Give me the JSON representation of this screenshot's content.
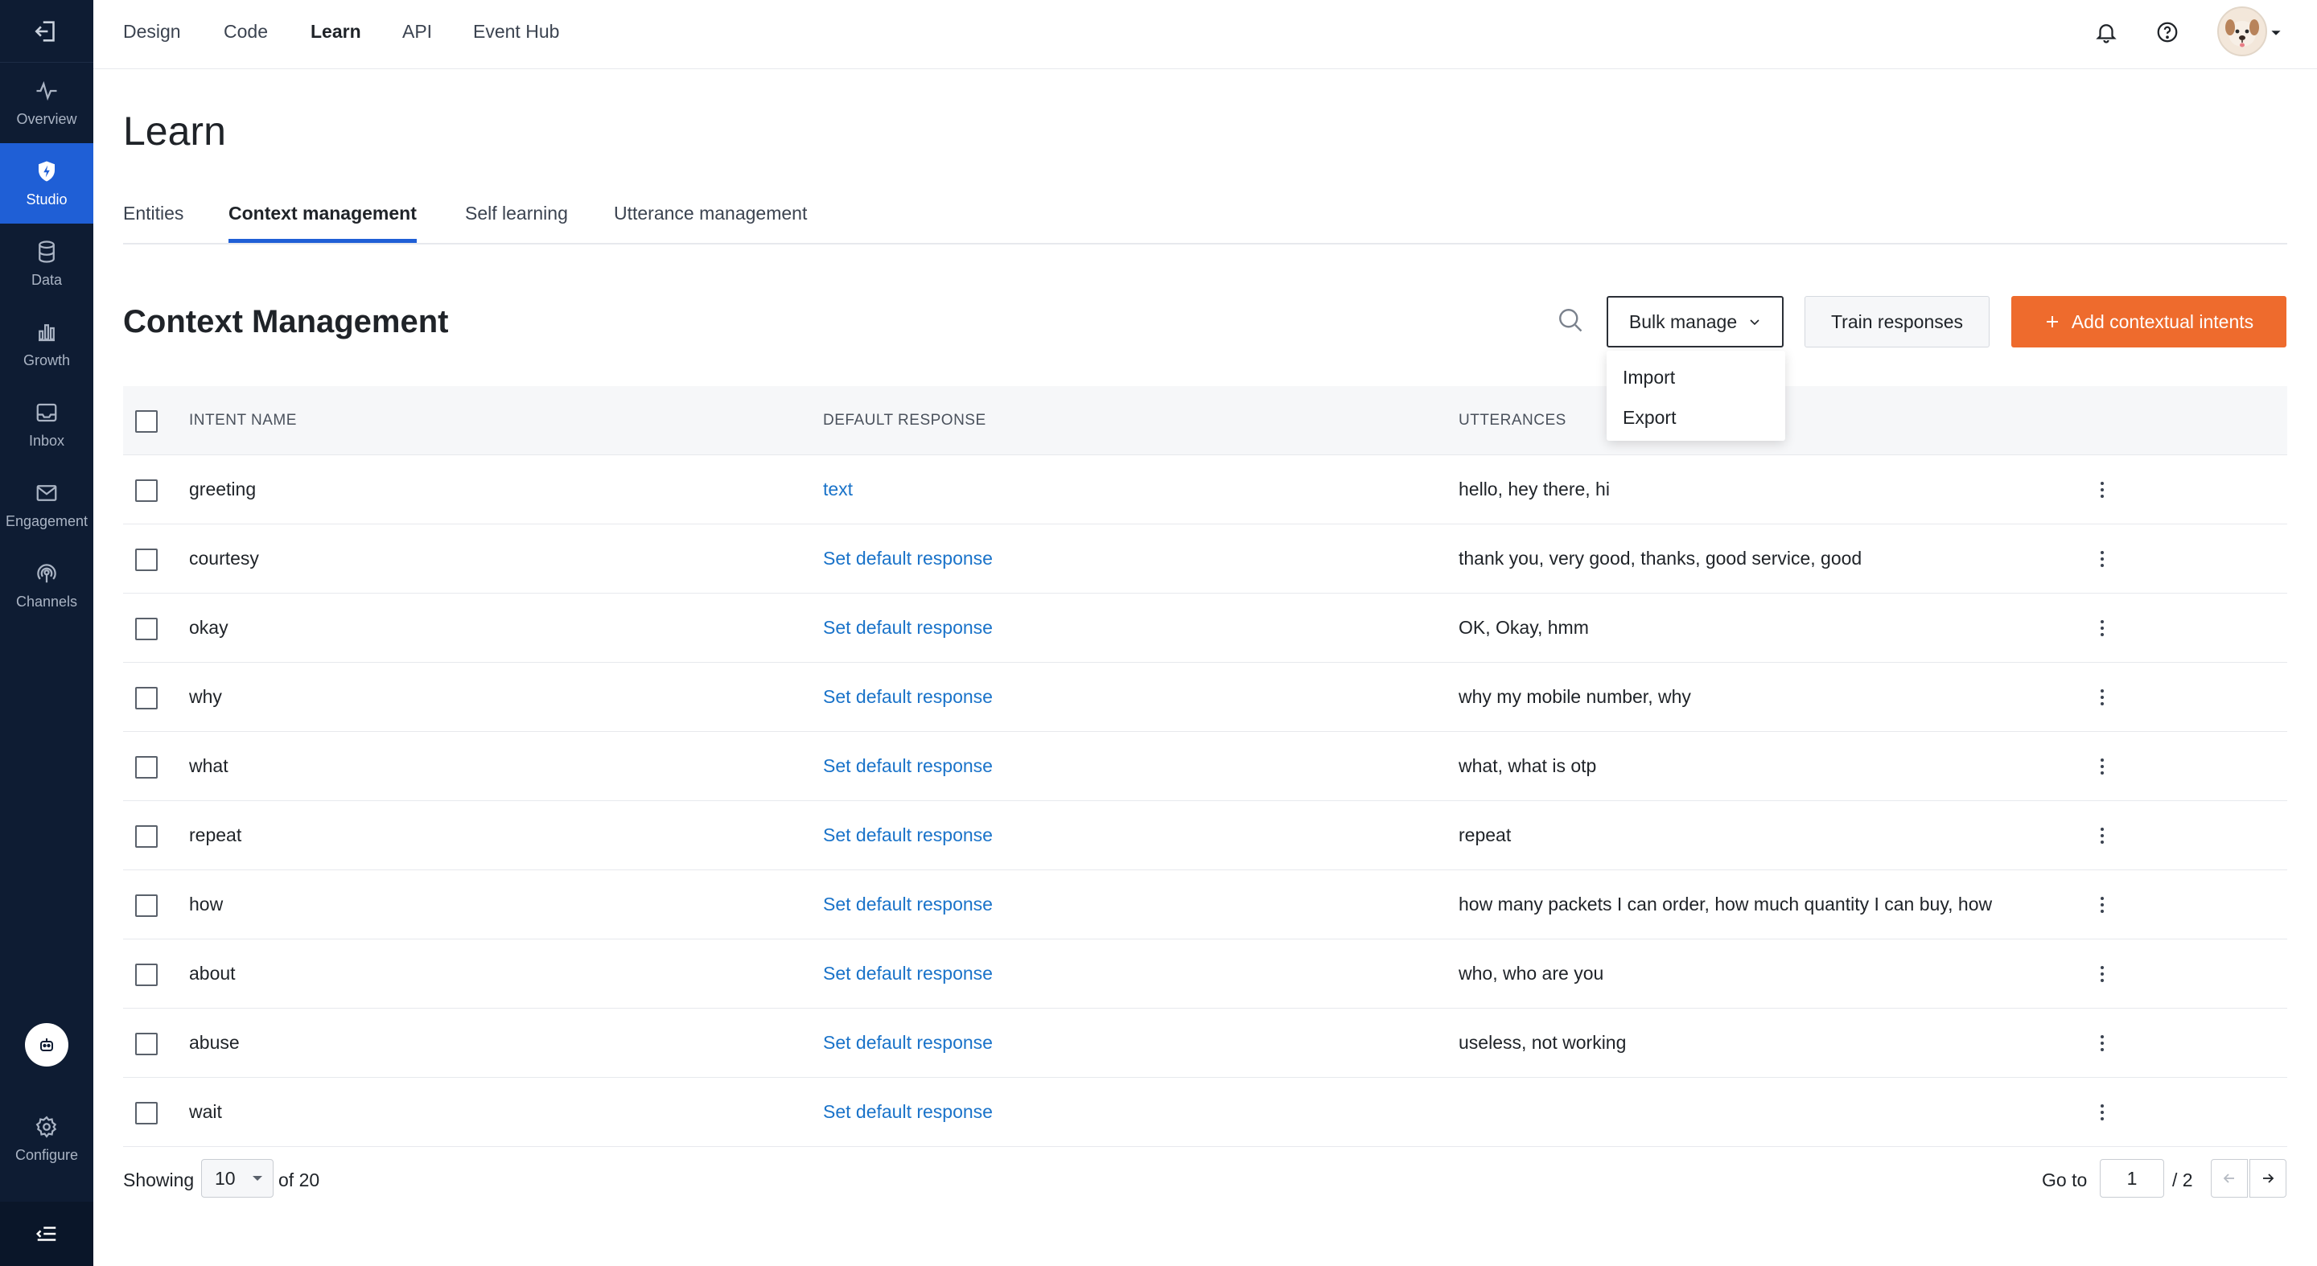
{
  "sidebar": {
    "items": [
      {
        "label": "Overview",
        "icon": "activity-icon"
      },
      {
        "label": "Studio",
        "icon": "shield-bolt-icon",
        "active": true
      },
      {
        "label": "Data",
        "icon": "database-icon"
      },
      {
        "label": "Growth",
        "icon": "bar-chart-icon"
      },
      {
        "label": "Inbox",
        "icon": "inbox-icon"
      },
      {
        "label": "Engagement",
        "icon": "mail-icon"
      },
      {
        "label": "Channels",
        "icon": "broadcast-icon"
      }
    ],
    "configure_label": "Configure"
  },
  "topnav": {
    "links": [
      "Design",
      "Code",
      "Learn",
      "API",
      "Event Hub"
    ],
    "active": "Learn"
  },
  "page": {
    "title": "Learn",
    "tabs": [
      "Entities",
      "Context management",
      "Self learning",
      "Utterance management"
    ],
    "active_tab": "Context management"
  },
  "section": {
    "title": "Context Management",
    "bulk_manage_label": "Bulk manage",
    "train_label": "Train responses",
    "add_label": "Add contextual intents",
    "dropdown": [
      "Import",
      "Export"
    ]
  },
  "table": {
    "headers": [
      "INTENT NAME",
      "DEFAULT RESPONSE",
      "UTTERANCES"
    ],
    "rows": [
      {
        "intent": "greeting",
        "response": "text",
        "utterances": "hello, hey there, hi"
      },
      {
        "intent": "courtesy",
        "response": "Set default response",
        "utterances": "thank you, very good, thanks, good service, good"
      },
      {
        "intent": "okay",
        "response": "Set default response",
        "utterances": "OK, Okay, hmm"
      },
      {
        "intent": "why",
        "response": "Set default response",
        "utterances": "why my mobile number, why"
      },
      {
        "intent": "what",
        "response": "Set default response",
        "utterances": "what, what is otp"
      },
      {
        "intent": "repeat",
        "response": "Set default response",
        "utterances": "repeat"
      },
      {
        "intent": "how",
        "response": "Set default response",
        "utterances": "how many packets I can order, how much quantity I can buy, how"
      },
      {
        "intent": "about",
        "response": "Set default response",
        "utterances": "who, who are you"
      },
      {
        "intent": "abuse",
        "response": "Set default response",
        "utterances": "useless, not working"
      },
      {
        "intent": "wait",
        "response": "Set default response",
        "utterances": ""
      }
    ]
  },
  "footer": {
    "showing_label": "Showing",
    "page_size": "10",
    "of_total": "of 20",
    "goto_label": "Go to",
    "current_page": "1",
    "total_pages": "/ 2"
  },
  "colors": {
    "sidebar_bg": "#0e1c33",
    "active_blue": "#1f5fd6",
    "accent_orange": "#ee6b2d",
    "link_blue": "#1a73c9"
  }
}
